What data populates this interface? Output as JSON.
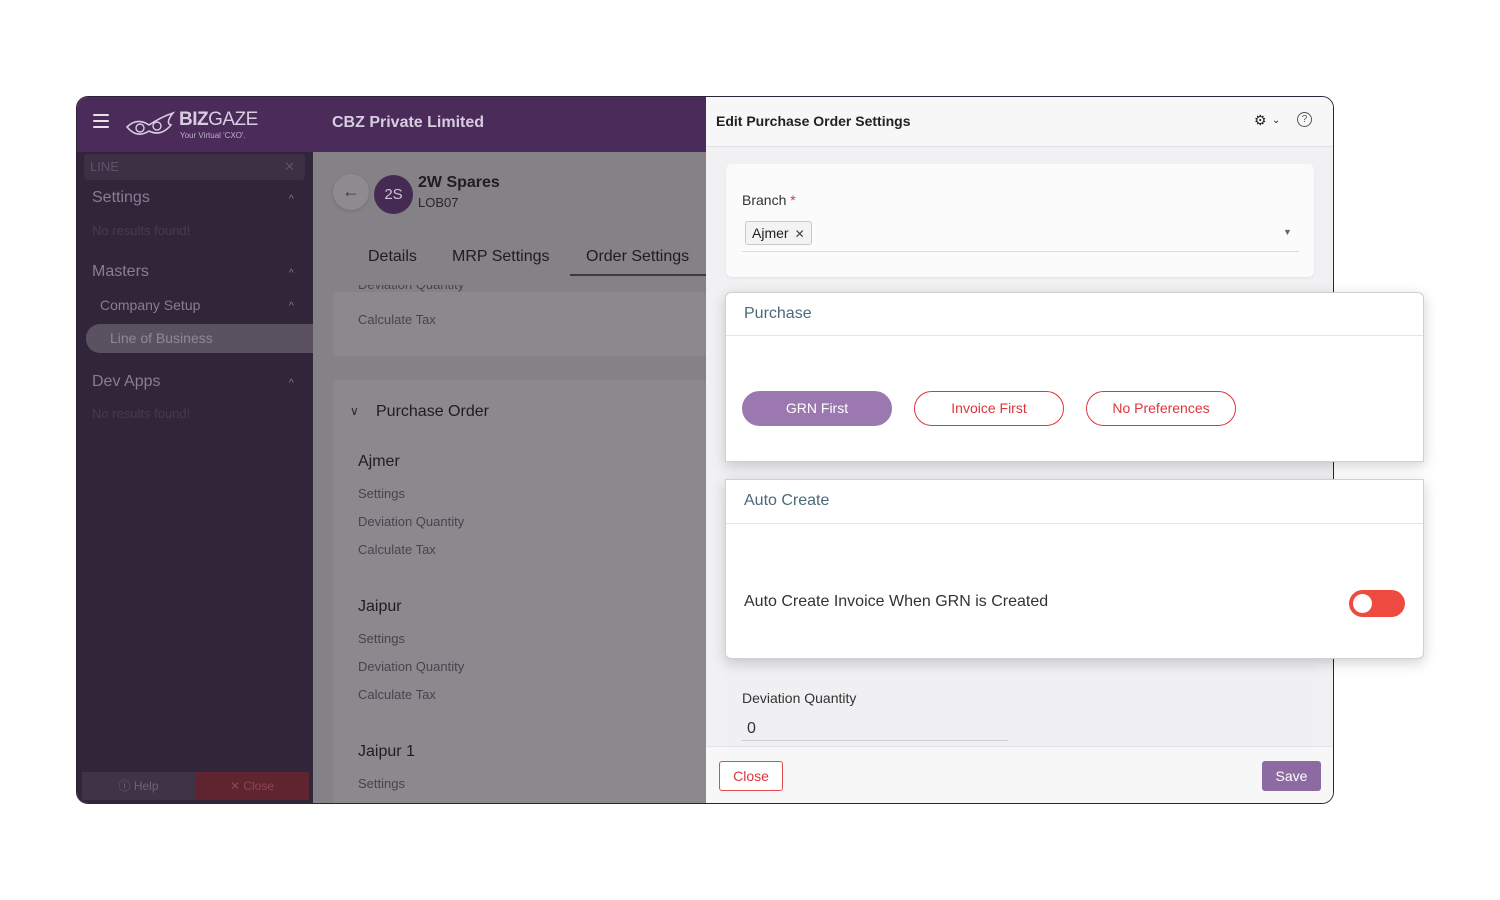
{
  "header": {
    "logo_text_bold": "BIZ",
    "logo_text_light": "GAZE",
    "logo_tagline": "Your Virtual 'CXO'.",
    "company": "CBZ Private Limited"
  },
  "sidebar": {
    "search_value": "LINE",
    "sections": [
      {
        "label": "Settings",
        "empty": "No results found!"
      },
      {
        "label": "Masters",
        "sub": "Company Setup",
        "active_item": "Line of Business"
      },
      {
        "label": "Dev Apps",
        "empty": "No results found!"
      }
    ],
    "help_label": "ⓘ Help",
    "close_label": "✕ Close"
  },
  "content": {
    "avatar": "2S",
    "name": "2W Spares",
    "code": "LOB07",
    "tabs": [
      "Details",
      "MRP Settings",
      "Order Settings"
    ],
    "top_card": [
      "Deviation Quantity",
      "Calculate Tax"
    ],
    "section_title": "Purchase Order",
    "branches": [
      {
        "name": "Ajmer",
        "items": [
          "Settings",
          "Deviation Quantity",
          "Calculate Tax"
        ]
      },
      {
        "name": "Jaipur",
        "items": [
          "Settings",
          "Deviation Quantity",
          "Calculate Tax"
        ]
      },
      {
        "name": "Jaipur 1",
        "items": [
          "Settings"
        ]
      }
    ]
  },
  "panel": {
    "title": "Edit Purchase Order Settings",
    "branch_label": "Branch",
    "branch_required": "*",
    "branch_value": "Ajmer",
    "deviation_label": "Deviation Quantity",
    "deviation_value": "0",
    "close_label": "Close",
    "save_label": "Save"
  },
  "purchase": {
    "title": "Purchase",
    "options": [
      "GRN First",
      "Invoice First",
      "No Preferences"
    ],
    "selected": "GRN First"
  },
  "auto_create": {
    "title": "Auto Create",
    "label": "Auto Create Invoice When GRN is Created",
    "enabled": false
  },
  "colors": {
    "brand_purple": "#4a2b59",
    "accent_red": "#e0343b",
    "selected_pill": "#9c78b0",
    "save_button": "#8e6aa3"
  },
  "icons": [
    "hamburger-icon",
    "owl-logo-icon",
    "chevron-up-icon",
    "back-arrow-icon",
    "chevron-down-icon",
    "gear-icon",
    "help-icon",
    "remove-chip-icon",
    "dropdown-caret-icon"
  ]
}
